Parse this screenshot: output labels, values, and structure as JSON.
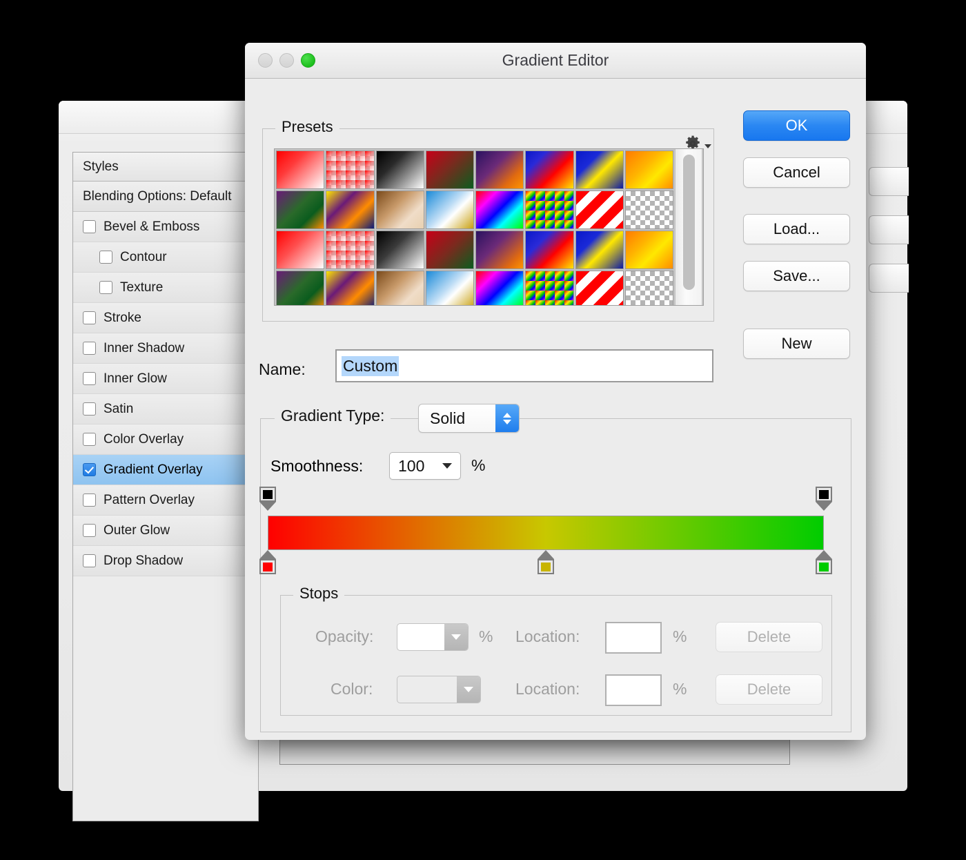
{
  "background_window": {
    "styles_header": "Styles",
    "blending_options": "Blending Options: Default",
    "effects": [
      {
        "label": "Bevel & Emboss",
        "checked": false,
        "indent": false,
        "selected": false
      },
      {
        "label": "Contour",
        "checked": false,
        "indent": true,
        "selected": false
      },
      {
        "label": "Texture",
        "checked": false,
        "indent": true,
        "selected": false
      },
      {
        "label": "Stroke",
        "checked": false,
        "indent": false,
        "selected": false
      },
      {
        "label": "Inner Shadow",
        "checked": false,
        "indent": false,
        "selected": false
      },
      {
        "label": "Inner Glow",
        "checked": false,
        "indent": false,
        "selected": false
      },
      {
        "label": "Satin",
        "checked": false,
        "indent": false,
        "selected": false
      },
      {
        "label": "Color Overlay",
        "checked": false,
        "indent": false,
        "selected": false
      },
      {
        "label": "Gradient Overlay",
        "checked": true,
        "indent": false,
        "selected": true
      },
      {
        "label": "Pattern Overlay",
        "checked": false,
        "indent": false,
        "selected": false
      },
      {
        "label": "Outer Glow",
        "checked": false,
        "indent": false,
        "selected": false
      },
      {
        "label": "Drop Shadow",
        "checked": false,
        "indent": false,
        "selected": false
      }
    ]
  },
  "dialog": {
    "title": "Gradient Editor",
    "traffic_lights": [
      "close-disabled",
      "minimize-disabled",
      "zoom-active"
    ],
    "presets": {
      "label": "Presets",
      "gear_menu_icon": "gear-icon",
      "swatches": [
        "linear-gradient(135deg,#ff0000 0%,#ff3b3b 35%,#ffffff 100%)",
        "linear-gradient(135deg,#ff0000 0%,rgba(255,80,80,0.55) 45%,rgba(255,255,255,0) 100%), repeating-conic-gradient(#cfcfcf 0% 25%, #ffffff 0% 50%)",
        "linear-gradient(135deg,#000000 0%,#2a2a2a 35%,#ffffff 100%)",
        "linear-gradient(135deg,#c80018 0%,#7a2a1e 45%,#0a5c1e 100%)",
        "linear-gradient(135deg,#2a1260 0%,#6b2a78 40%,#e06a10 75%,#ff9500 100%)",
        "linear-gradient(135deg,#0a18c8 0%,#2a2ad8 25%,#ff0000 60%,#ffe800 100%)",
        "linear-gradient(135deg,#0a18c8 0%,#1a2ad8 30%,#ffe800 55%,#0a18a8 100%)",
        "linear-gradient(135deg,#ff7a00 0%,#ffb400 40%,#ffe800 65%,#ff8c00 100%)",
        "linear-gradient(135deg,#6a1a78 0%,#2a6a2a 45%,#0a5c1e 70%,#ff8c00 100%)",
        "linear-gradient(135deg,#ffe800 0%,#6a1a78 35%,#ff8c00 65%,#0a1a7a 100%)",
        "linear-gradient(135deg,#7a4a1a 0%,#c89a6a 40%,#f0ddc8 70%,#e8d0b0 100%)",
        "linear-gradient(135deg,#1a8ad8 0%,#bcdcf5 45%,#ffffff 60%,#c8a010 100%)",
        "linear-gradient(135deg,#ff0000 0%,#ff00ff 25%,#0000ff 50%,#00ffff 70%,#00ff00 100%)",
        "linear-gradient(135deg,#ff0000 0%,#ffe800 30%,#00c800 55%,#0000ff 75%,#ff00ff 100%), repeating-conic-gradient(#cfcfcf 0% 25%, #ffffff 0% 50%)",
        "repeating-linear-gradient(135deg,#ff0000 0 14px,#ffffff 14px 26px)",
        "repeating-conic-gradient(#b4b4b4 0% 25%, #ffffff 0% 50%)",
        "linear-gradient(135deg,#ff0000 0%,#ff5050 40%,#ffffff 100%)",
        "linear-gradient(135deg,#ff0000 0%,rgba(255,80,80,0.5) 45%,rgba(255,255,255,0) 100%), repeating-conic-gradient(#cfcfcf 0% 25%, #ffffff 0% 50%)",
        "linear-gradient(135deg,#000000 0%,#3a3a3a 40%,#ffffff 100%)",
        "linear-gradient(135deg,#c80018 0%,#7a2a1e 50%,#0a5c1e 100%)",
        "linear-gradient(135deg,#2a1260 0%,#6b2a78 40%,#e06a10 80%,#ff9500 100%)",
        "linear-gradient(135deg,#0a18c8 0%,#2a2ad8 30%,#ff0000 60%,#ffe800 100%)",
        "linear-gradient(135deg,#0a18c8 0%,#1a2ad8 30%,#ffe800 55%,#0a18a8 100%)",
        "linear-gradient(135deg,#ff7a00 0%,#ffb400 35%,#ffe800 60%,#ff8c00 100%)",
        "linear-gradient(135deg,#6a1a78 0%,#2a6a2a 45%,#0a5c1e 70%,#ff8c00 100%)",
        "linear-gradient(135deg,#ffe800 0%,#6a1a78 35%,#ff8c00 65%,#0a1a7a 100%)",
        "linear-gradient(135deg,#7a4a1a 0%,#c89a6a 40%,#f0ddc8 70%,#e8d0b0 100%)",
        "linear-gradient(135deg,#1a8ad8 0%,#bcdcf5 45%,#ffffff 60%,#c8a010 100%)",
        "linear-gradient(135deg,#ff0000 0%,#ff00ff 25%,#0000ff 50%,#00ffff 70%,#00ff00 100%)",
        "linear-gradient(135deg,#ff0000 0%,#ffe800 30%,#00c800 55%,#0000ff 75%,#ff00ff 100%), repeating-conic-gradient(#cfcfcf 0% 25%, #ffffff 0% 50%)",
        "repeating-linear-gradient(135deg,#ff0000 0 14px,#ffffff 14px 26px)",
        "repeating-conic-gradient(#b4b4b4 0% 25%, #ffffff 0% 50%)",
        "linear-gradient(135deg,#1a8ad8 0%,#bcdcf5 45%,#ffffff 58%,#c8a010 100%)",
        "linear-gradient(135deg,#ff0000 0%,#ff00ff 28%,#0000ff 52%,#00ffff 72%,#00ff00 100%)",
        "linear-gradient(135deg,#ffffff 0%,#ff0000 25%,#ffe800 50%,#00c800 72%,#0000ff 100%), repeating-conic-gradient(#cfcfcf 0% 25%, #ffffff 0% 50%)",
        "repeating-linear-gradient(135deg,#ff0000 0 14px,#ffffff 14px 26px)",
        "repeating-conic-gradient(#b4b4b4 0% 25%, #ffffff 0% 50%)",
        "linear-gradient(135deg,#0a1a7a 0%,#1a5ad8 35%,#00d0ff 60%,#ff3000 100%)",
        "repeating-conic-gradient(#cfcfcf 0% 25%, #ffffff 0% 50%)"
      ],
      "scrollbar": "vertical-scrollbar"
    },
    "buttons": {
      "ok": "OK",
      "cancel": "Cancel",
      "load": "Load...",
      "save": "Save...",
      "new": "New"
    },
    "name": {
      "label": "Name:",
      "value": "Custom",
      "selected": true
    },
    "gradient_type": {
      "label": "Gradient Type:",
      "value": "Solid",
      "options": [
        "Solid",
        "Noise"
      ]
    },
    "smoothness": {
      "label": "Smoothness:",
      "value": "100",
      "unit": "%"
    },
    "gradient_preview": {
      "css": "linear-gradient(90deg,#ff0000 0%,#c8c800 50%,#00cc00 100%)",
      "opacity_stops": [
        {
          "location": 0,
          "color": "#000000",
          "opacity": 100
        },
        {
          "location": 100,
          "color": "#000000",
          "opacity": 100
        }
      ],
      "color_stops": [
        {
          "location": 0,
          "color": "#ff0000"
        },
        {
          "location": 50,
          "color": "#c8b400"
        },
        {
          "location": 100,
          "color": "#00cc00"
        }
      ]
    },
    "stops": {
      "label": "Stops",
      "opacity_label": "Opacity:",
      "opacity_value": "",
      "opacity_unit": "%",
      "opacity_location_label": "Location:",
      "opacity_location_value": "",
      "opacity_location_unit": "%",
      "opacity_delete": "Delete",
      "color_label": "Color:",
      "color_value": "",
      "color_location_label": "Location:",
      "color_location_value": "",
      "color_location_unit": "%",
      "color_delete": "Delete",
      "enabled": false
    }
  },
  "colors": {
    "accent_blue": "#1f7ded",
    "selection_blue": "#8ec3f0",
    "text_selection": "#b4d7fb",
    "window_bg": "#ececec",
    "gradient_start": "#ff0000",
    "gradient_mid": "#c8c800",
    "gradient_end": "#00cc00"
  }
}
